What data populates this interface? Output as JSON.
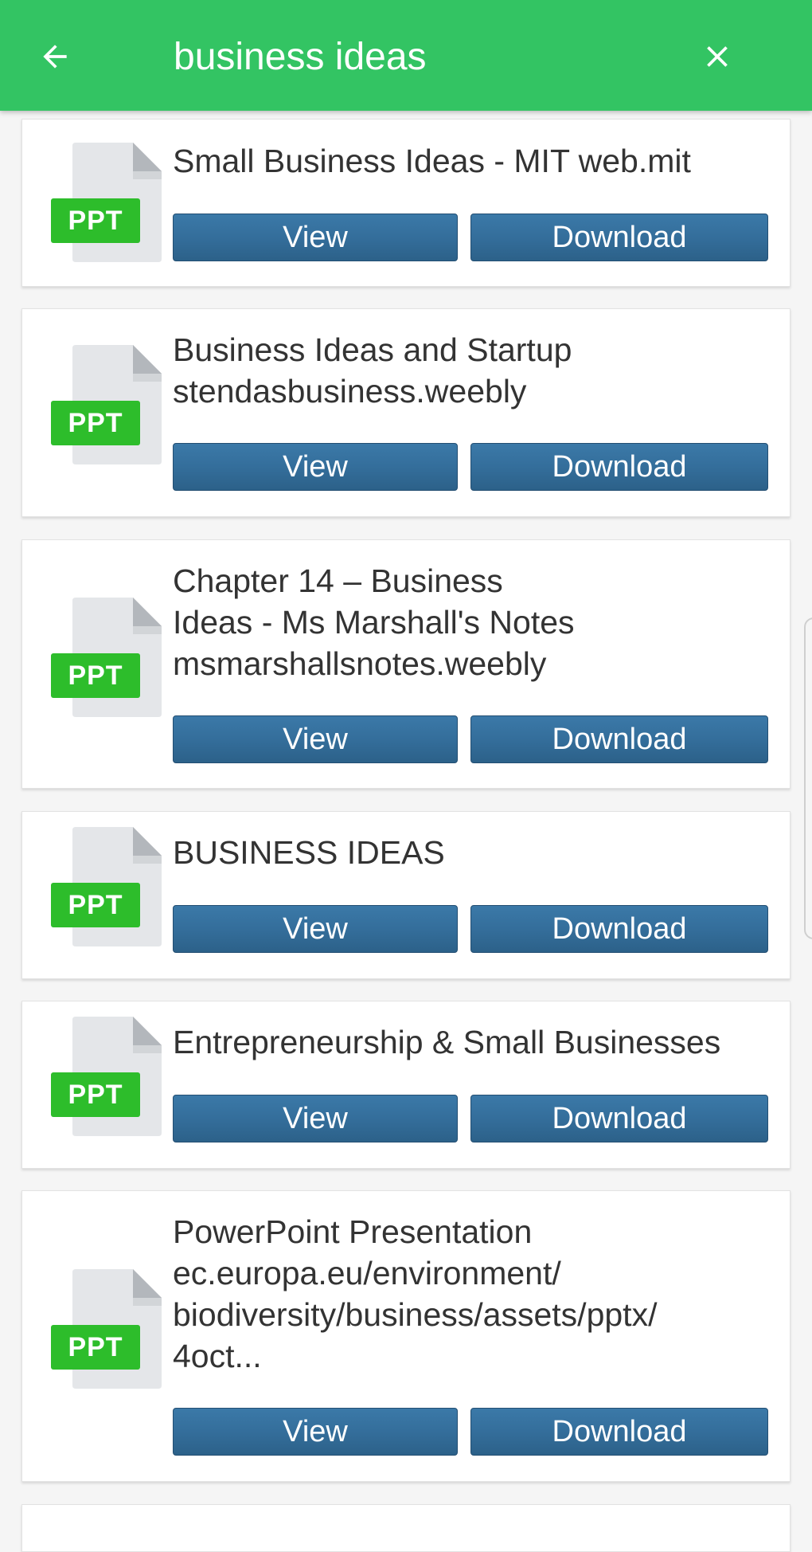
{
  "search": {
    "query": "business ideas"
  },
  "icons": {
    "back": "arrow-back-icon",
    "close": "close-icon",
    "file": "ppt-file-icon"
  },
  "colors": {
    "header": "#33c463",
    "badge": "#2dbd2b",
    "button": "#346e9b"
  },
  "results": [
    {
      "badge": "PPT",
      "title": "Small Business Ideas - MIT web.mit",
      "view_label": "View",
      "download_label": "Download"
    },
    {
      "badge": "PPT",
      "title": "Business Ideas and Startup\nstendasbusiness.weebly",
      "view_label": "View",
      "download_label": "Download"
    },
    {
      "badge": "PPT",
      "title": "Chapter 14 – Business\nIdeas - Ms Marshall's Notes\nmsmarshallsnotes.weebly",
      "view_label": "View",
      "download_label": "Download"
    },
    {
      "badge": "PPT",
      "title": "BUSINESS IDEAS",
      "view_label": "View",
      "download_label": "Download"
    },
    {
      "badge": "PPT",
      "title": "Entrepreneurship & Small Businesses",
      "view_label": "View",
      "download_label": "Download"
    },
    {
      "badge": "PPT",
      "title": "PowerPoint Presentation\nec.europa.eu/environment/\nbiodiversity/business/assets/pptx/\n4oct...",
      "view_label": "View",
      "download_label": "Download"
    }
  ]
}
